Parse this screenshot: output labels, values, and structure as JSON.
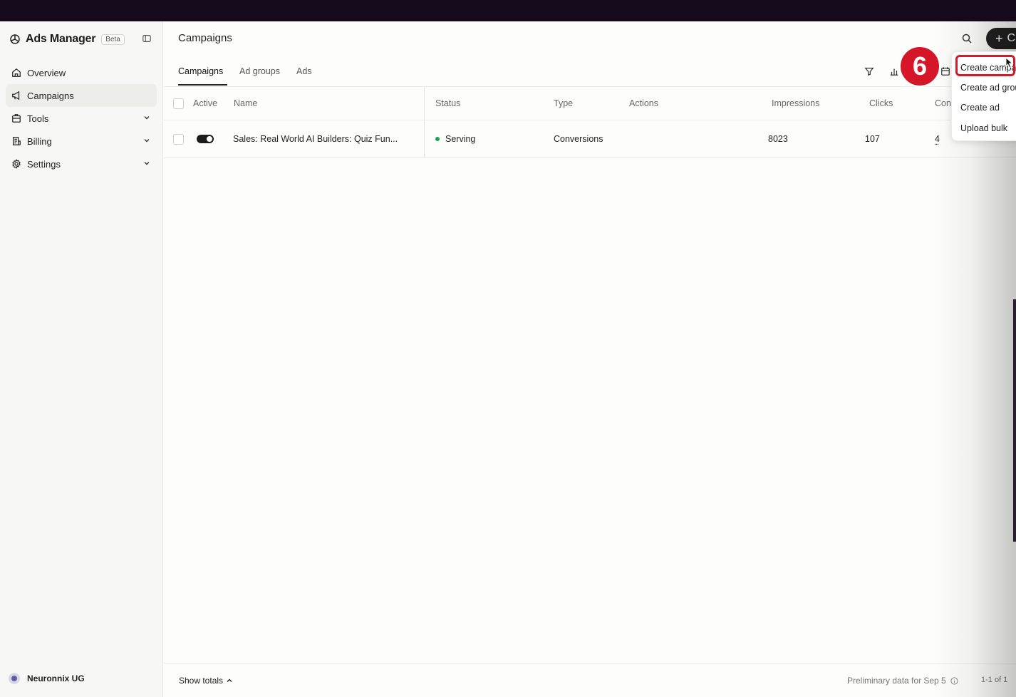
{
  "sidebar": {
    "brand": "Ads Manager",
    "badge": "Beta",
    "items": [
      {
        "label": "Overview",
        "icon": "home-icon"
      },
      {
        "label": "Campaigns",
        "icon": "megaphone-icon",
        "active": true
      },
      {
        "label": "Tools",
        "icon": "briefcase-icon",
        "expandable": true
      },
      {
        "label": "Billing",
        "icon": "receipt-icon",
        "expandable": true
      },
      {
        "label": "Settings",
        "icon": "gear-icon",
        "expandable": true
      }
    ],
    "account": "Neuronnix UG"
  },
  "header": {
    "title": "Campaigns",
    "new_button_label": "C"
  },
  "tabs": [
    "Campaigns",
    "Ad groups",
    "Ads"
  ],
  "table": {
    "columns": [
      "Active",
      "Name",
      "Status",
      "Type",
      "Actions",
      "Impressions",
      "Clicks",
      "Con"
    ],
    "rows": [
      {
        "active": true,
        "name": "Sales: Real World AI Builders: Quiz Fun...",
        "status": "Serving",
        "type": "Conversions",
        "actions": "",
        "impressions": "8023",
        "clicks": "107",
        "conversions": "4"
      }
    ]
  },
  "footer": {
    "show_totals": "Show totals",
    "preliminary": "Preliminary data for Sep 5",
    "pagination": "1-1 of 1"
  },
  "dropdown": {
    "items": [
      "Create campa",
      "Create ad grou",
      "Create ad",
      "Upload bulk"
    ]
  },
  "annotation": {
    "step": "6",
    "color": "#d41628"
  },
  "colors": {
    "status_serving": "#1aa34a",
    "accent_dark": "#222222"
  }
}
